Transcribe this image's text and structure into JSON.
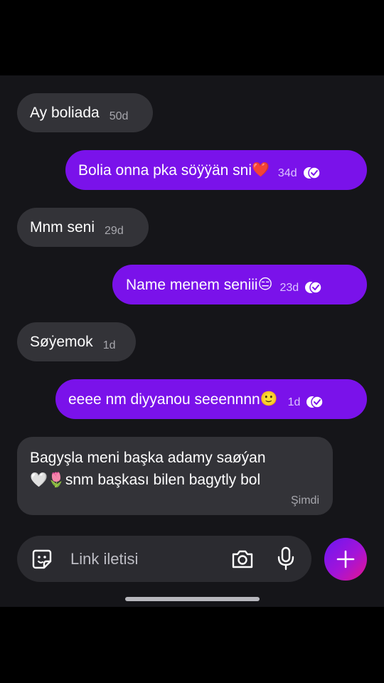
{
  "messages": [
    {
      "direction": "in",
      "text": "Ay boliada",
      "time": "50d"
    },
    {
      "direction": "out",
      "text": "Bolia onna pka söÿÿän sni",
      "emoji": "❤️",
      "time": "34d"
    },
    {
      "direction": "in",
      "text": "Mnm seni",
      "time": "29d"
    },
    {
      "direction": "out",
      "text": "Name menem seniii",
      "emoji": "😑",
      "time": "23d"
    },
    {
      "direction": "in",
      "text": "Søẏemok",
      "time": "1d"
    },
    {
      "direction": "out",
      "text": "eeee nm diyyanou seeennnn",
      "emoji": "🙂",
      "time": "1d"
    },
    {
      "direction": "in",
      "line1": "Bagyşla meni başka adamy saøýan",
      "line2_emoji": "🤍🌷",
      "line2_text": "snm başkası bilen bagytly bol",
      "time": "Şimdi"
    }
  ],
  "composer": {
    "placeholder": "Link iletisi",
    "sticker_icon": "sticker-icon",
    "camera_icon": "camera-icon",
    "mic_icon": "microphone-icon",
    "plus_icon": "plus-icon"
  },
  "colors": {
    "incoming_bubble": "#333338",
    "outgoing_bubble": "#7a12ea",
    "chat_background": "#151519",
    "composer_background": "#2b2b30"
  }
}
